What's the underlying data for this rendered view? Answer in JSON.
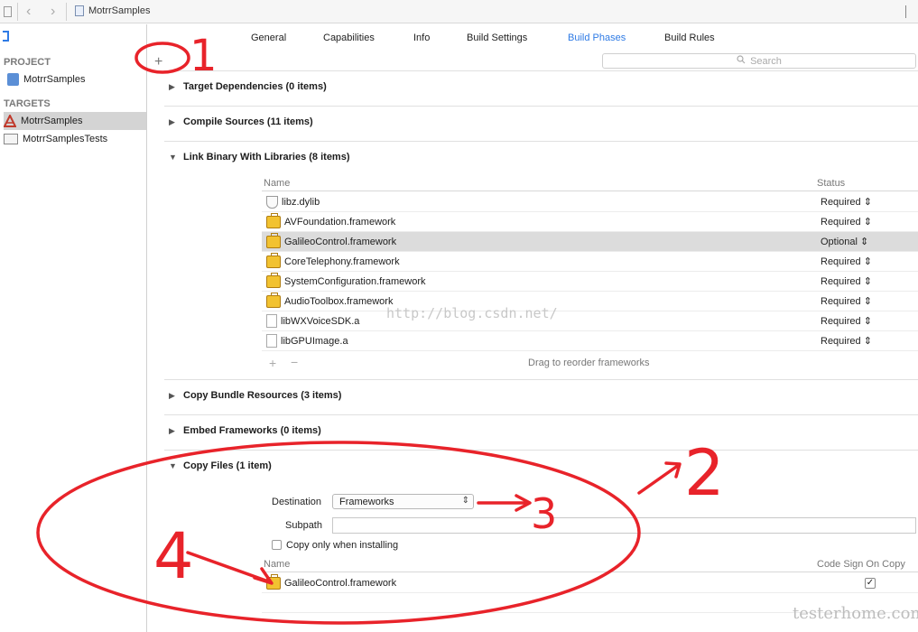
{
  "window": {
    "crumb": "MotrrSamples"
  },
  "tabs": [
    "General",
    "Capabilities",
    "Info",
    "Build Settings",
    "Build Phases",
    "Build Rules"
  ],
  "sidebar": {
    "project_header": "PROJECT",
    "project_item": "MotrrSamples",
    "targets_header": "TARGETS",
    "targets": [
      "MotrrSamples",
      "MotrrSamplesTests"
    ]
  },
  "toolbar": {
    "add": "+",
    "search_placeholder": "Search"
  },
  "phases": {
    "target_deps": "Target Dependencies (0 items)",
    "compile": "Compile Sources (11 items)",
    "link": "Link Binary With Libraries (8 items)",
    "bundle": "Copy Bundle Resources (3 items)",
    "embed": "Embed Frameworks (0 items)",
    "copy": "Copy Files (1 item)"
  },
  "link_table": {
    "col_name": "Name",
    "col_status": "Status",
    "rows": [
      {
        "name": "libz.dylib",
        "status": "Required",
        "icon": "library-icon"
      },
      {
        "name": "AVFoundation.framework",
        "status": "Required",
        "icon": "framework-icon"
      },
      {
        "name": "GalileoControl.framework",
        "status": "Optional",
        "icon": "framework-icon"
      },
      {
        "name": "CoreTelephony.framework",
        "status": "Required",
        "icon": "framework-icon"
      },
      {
        "name": "SystemConfiguration.framework",
        "status": "Required",
        "icon": "framework-icon"
      },
      {
        "name": "AudioToolbox.framework",
        "status": "Required",
        "icon": "framework-icon"
      },
      {
        "name": "libWXVoiceSDK.a",
        "status": "Required",
        "icon": "file-icon"
      },
      {
        "name": "libGPUImage.a",
        "status": "Required",
        "icon": "file-icon"
      }
    ],
    "drag_hint": "Drag to reorder frameworks"
  },
  "copy_files": {
    "destination_label": "Destination",
    "destination_value": "Frameworks",
    "subpath_label": "Subpath",
    "subpath_value": "",
    "copy_only_label": "Copy only when installing",
    "col_name": "Name",
    "col_codesign": "Code Sign On Copy",
    "file": "GalileoControl.framework"
  },
  "annotations": {
    "n1": "1",
    "n2": "2",
    "n3": "3",
    "n4": "4"
  },
  "watermarks": {
    "csdn": "http://blog.csdn.net/",
    "testerhome": "testerhome.com"
  },
  "colors": {
    "accent": "#2f7be5",
    "annotation_red": "#e8232a",
    "selection": "#dcdcdc"
  }
}
